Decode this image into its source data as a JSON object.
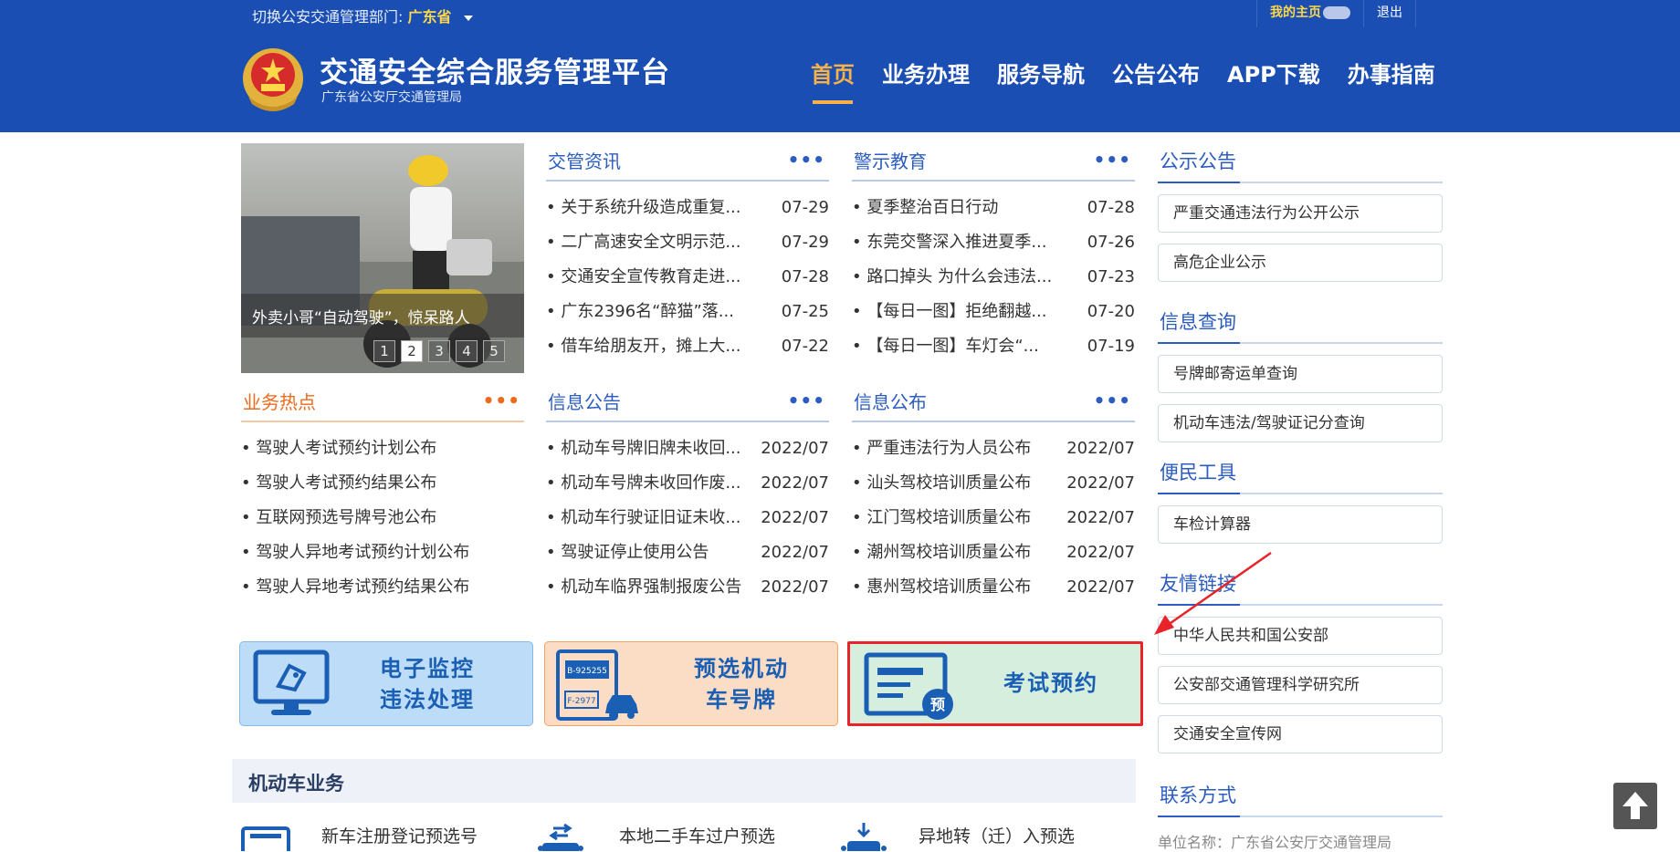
{
  "topbar": {
    "dept_label": "切换公安交通管理部门:",
    "dept_value": "广东省",
    "home_label": "我的主页",
    "logout_label": "退出"
  },
  "header": {
    "title": "交通安全综合服务管理平台",
    "subtitle": "广东省公安厅交通管理局",
    "nav": [
      {
        "label": "首页",
        "active": true
      },
      {
        "label": "业务办理"
      },
      {
        "label": "服务导航"
      },
      {
        "label": "公告公布"
      },
      {
        "label": "APP下载"
      },
      {
        "label": "办事指南"
      }
    ]
  },
  "slider": {
    "caption": "外卖小哥“自动驾驶”，惊呆路人",
    "pages": [
      "1",
      "2",
      "3",
      "4",
      "5"
    ],
    "current": "2"
  },
  "panels": {
    "jiaoguan": {
      "title": "交管资讯",
      "more": "•••",
      "items": [
        {
          "text": "• 关于系统升级造成重复...",
          "date": "07-29"
        },
        {
          "text": "• 二广高速安全文明示范...",
          "date": "07-29"
        },
        {
          "text": "• 交通安全宣传教育走进...",
          "date": "07-28"
        },
        {
          "text": "• 广东2396名“醉猫”落...",
          "date": "07-25"
        },
        {
          "text": "• 借车给朋友开，摊上大...",
          "date": "07-22"
        }
      ]
    },
    "jingshi": {
      "title": "警示教育",
      "more": "•••",
      "items": [
        {
          "text": "• 夏季整治百日行动",
          "date": "07-28"
        },
        {
          "text": "• 东莞交警深入推进夏季...",
          "date": "07-26"
        },
        {
          "text": "• 路口掉头 为什么会违法...",
          "date": "07-23"
        },
        {
          "text": "• 【每日一图】拒绝翻越...",
          "date": "07-20"
        },
        {
          "text": "• 【每日一图】车灯会“...",
          "date": "07-19"
        }
      ]
    },
    "redian": {
      "title": "业务热点",
      "more": "•••",
      "items": [
        {
          "text": "• 驾驶人考试预约计划公布"
        },
        {
          "text": "• 驾驶人考试预约结果公布"
        },
        {
          "text": "• 互联网预选号牌号池公布"
        },
        {
          "text": "• 驾驶人异地考试预约计划公布"
        },
        {
          "text": "• 驾驶人异地考试预约结果公布"
        }
      ]
    },
    "xinxigonggao": {
      "title": "信息公告",
      "more": "•••",
      "items": [
        {
          "text": "• 机动车号牌旧牌未收回...",
          "date": "2022/07"
        },
        {
          "text": "• 机动车号牌未收回作废...",
          "date": "2022/07"
        },
        {
          "text": "• 机动车行驶证旧证未收...",
          "date": "2022/07"
        },
        {
          "text": "• 驾驶证停止使用公告",
          "date": "2022/07"
        },
        {
          "text": "• 机动车临界强制报废公告",
          "date": "2022/07"
        }
      ]
    },
    "xinxigongbu": {
      "title": "信息公布",
      "more": "•••",
      "items": [
        {
          "text": "• 严重违法行为人员公布",
          "date": "2022/07"
        },
        {
          "text": "• 汕头驾校培训质量公布",
          "date": "2022/07"
        },
        {
          "text": "• 江门驾校培训质量公布",
          "date": "2022/07"
        },
        {
          "text": "• 潮州驾校培训质量公布",
          "date": "2022/07"
        },
        {
          "text": "• 惠州驾校培训质量公布",
          "date": "2022/07"
        }
      ]
    }
  },
  "cards": {
    "monitor": {
      "line1": "电子监控",
      "line2": "违法处理"
    },
    "plate": {
      "line1": "预选机动",
      "line2": "车号牌",
      "plate_a": "B-925255",
      "plate_b": "F-2977"
    },
    "exam": {
      "label": "考试预约",
      "badge": "预"
    }
  },
  "section": {
    "title": "机动车业务",
    "items": [
      "新车注册登记预选号",
      "本地二手车过户预选",
      "异地转（迁）入预选"
    ]
  },
  "right": {
    "gongshi": {
      "title": "公示公告",
      "items": [
        "严重交通违法行为公开公示",
        "高危企业公示"
      ]
    },
    "chaxun": {
      "title": "信息查询",
      "items": [
        "号牌邮寄运单查询",
        "机动车违法/驾驶证记分查询"
      ]
    },
    "gongju": {
      "title": "便民工具",
      "items": [
        "车检计算器"
      ]
    },
    "lianjie": {
      "title": "友情链接",
      "items": [
        "中华人民共和国公安部",
        "公安部交通管理科学研究所",
        "交通安全宣传网"
      ]
    },
    "lianxi": {
      "title": "联系方式",
      "line": "单位名称：广东省公安厅交通管理局"
    }
  },
  "colors": {
    "brand_blue": "#1a4eb3",
    "accent_orange": "#f7b24a",
    "annotation_red": "#e8232a"
  }
}
